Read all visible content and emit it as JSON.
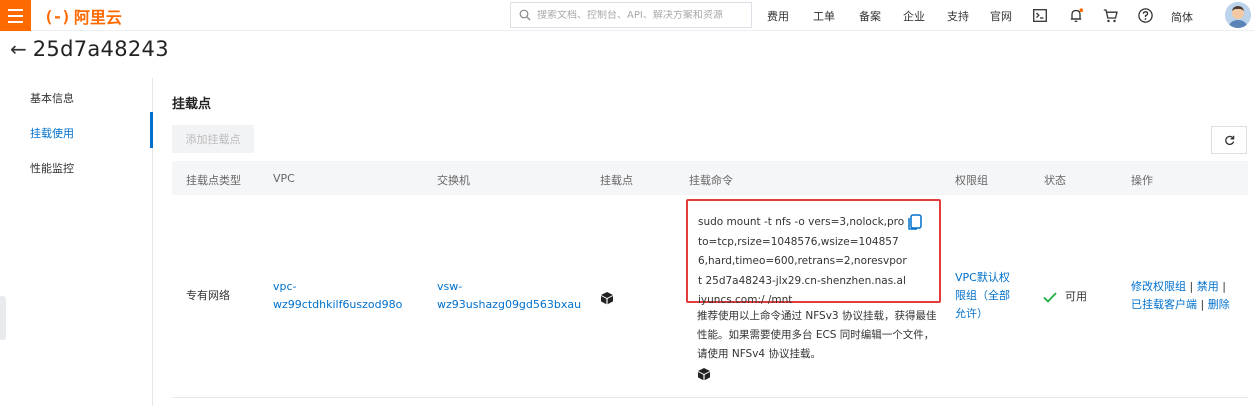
{
  "topbar": {
    "logo_mark": "(-)",
    "logo_text": "阿里云",
    "search_placeholder": "搜索文档、控制台、API、解决方案和资源",
    "links": [
      "费用",
      "工单",
      "备案",
      "企业",
      "支持",
      "官网"
    ],
    "lang": "简体"
  },
  "page": {
    "back_arrow": "←",
    "title": "25d7a48243"
  },
  "leftnav": {
    "items": [
      "基本信息",
      "挂载使用",
      "性能监控"
    ],
    "active_index": 1
  },
  "section": {
    "title": "挂载点",
    "add_button": "添加挂载点"
  },
  "table": {
    "headers": [
      "挂载点类型",
      "VPC",
      "交换机",
      "挂载点",
      "挂载命令",
      "权限组",
      "状态",
      "操作"
    ],
    "row": {
      "type": "专有网络",
      "vpc_line1": "vpc-",
      "vpc_line2": "wz99ctdhkilf6uszod98o",
      "vsw_line1": "vsw-",
      "vsw_line2": "wz93ushazg09gd563bxau",
      "command": "sudo mount -t nfs -o vers=3,nolock,proto=tcp,rsize=1048576,wsize=1048576,hard,timeo=600,retrans=2,noresvport 25d7a48243-jlx29.cn-shenzhen.nas.aliyuncs.com:/ /mnt",
      "note": "推荐使用以上命令通过 NFSv3 协议挂载，获得最佳性能。如果需要使用多台 ECS 同时编辑一个文件，请使用 NFSv4 协议挂载。",
      "permission_group": "VPC默认权限组（全部允许）",
      "status": "可用",
      "ops": {
        "modify": "修改权限组",
        "disable": "禁用",
        "clients": "已挂载客户端",
        "delete": "删除",
        "separator": "|"
      }
    }
  },
  "colors": {
    "brand": "#ff6a00",
    "link": "#0070cc",
    "highlight_border": "#e23c3c",
    "status_ok": "#1fae3f"
  }
}
